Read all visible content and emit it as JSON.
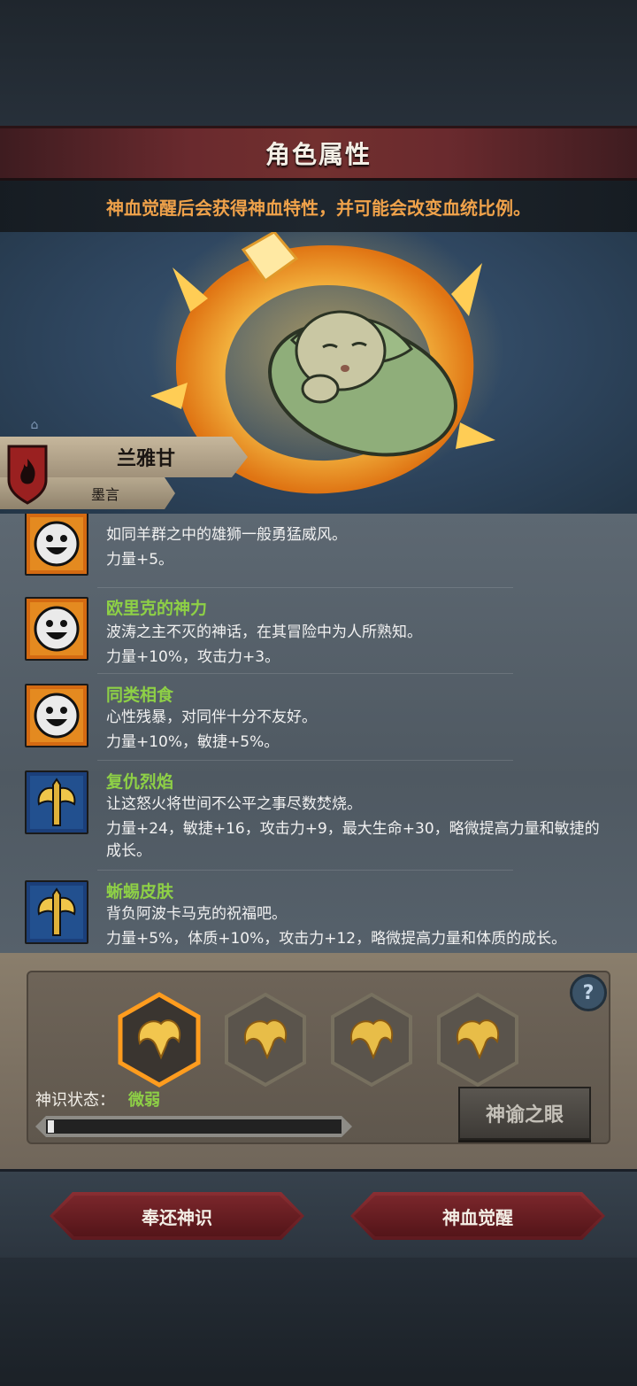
{
  "header": {
    "title": "角色属性",
    "subtitle": "神血觉醒后会获得神血特性，并可能会改变血统比例。"
  },
  "character": {
    "name": "兰雅甘",
    "subname": "墨言"
  },
  "traits": [
    {
      "name": "",
      "icon": "smile-face-icon",
      "desc": "如同羊群之中的雄狮一般勇猛威风。",
      "effect": "力量+5。"
    },
    {
      "name": "欧里克的神力",
      "icon": "smile-face-icon",
      "desc": "波涛之主不灭的神话，在其冒险中为人所熟知。",
      "effect": "力量+10%，攻击力+3。"
    },
    {
      "name": "同类相食",
      "icon": "smile-face-icon",
      "desc": "心性残暴，对同伴十分不友好。",
      "effect": "力量+10%，敏捷+5%。"
    },
    {
      "name": "复仇烈焰",
      "icon": "golden-axe-icon",
      "desc": "让这怒火将世间不公平之事尽数焚烧。",
      "effect": "力量+24，敏捷+16，攻击力+9，最大生命+30，略微提高力量和敏捷的成长。"
    },
    {
      "name": "蜥蜴皮肤",
      "icon": "golden-axe-icon",
      "desc": "背负阿波卡马克的祝福吧。",
      "effect": "力量+5%，体质+10%，攻击力+12，略微提高力量和体质的成长。"
    }
  ],
  "divine": {
    "status_label": "神识状态：",
    "status_value": "微弱",
    "progress": 0.02,
    "oracle_button": "神谕之眼",
    "help": "?"
  },
  "actions": {
    "return_label": "奉还神识",
    "awaken_label": "神血觉醒"
  },
  "colors": {
    "accent_green": "#8ed046",
    "subtitle_orange": "#f0a24a",
    "banner_red": "#6a2a2e"
  }
}
